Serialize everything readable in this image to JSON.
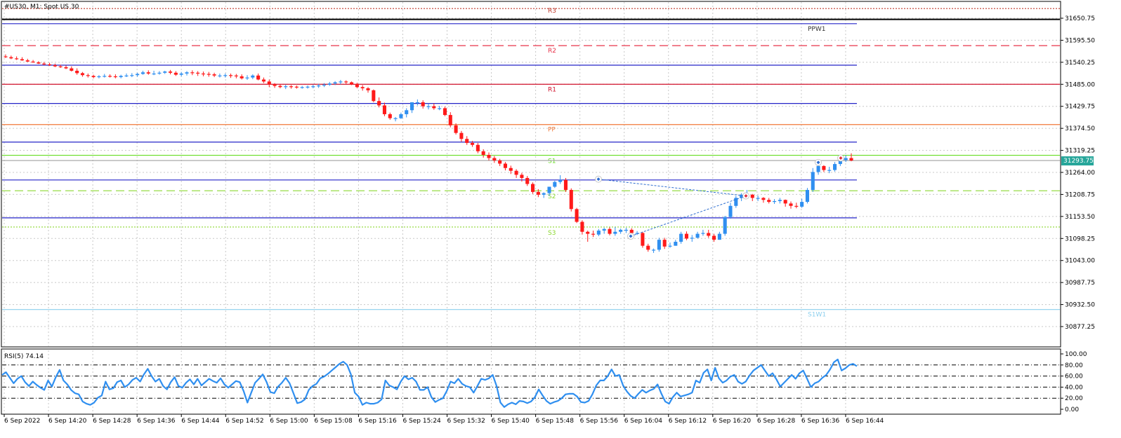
{
  "window": {
    "title": "#US30, M1:  Spot US 30"
  },
  "indicator": {
    "label": "RSI(5) 74.14"
  },
  "colors": {
    "bull": "#2f8ff0",
    "bear": "#ff1a1a",
    "rsi_line": "#2f8ff0",
    "grid": "#c8c8c8",
    "price_tag": "#26a69a"
  },
  "chart_data": [
    {
      "type": "candlestick",
      "title": "#US30, M1:  Spot US 30",
      "y_ticks": [
        "31650.75",
        "31595.50",
        "31540.25",
        "31485.00",
        "31429.75",
        "31374.50",
        "31319.25",
        "31264.00",
        "31208.75",
        "31153.50",
        "31098.25",
        "31043.00",
        "30987.75",
        "30932.50",
        "30877.25"
      ],
      "ylim": [
        30855,
        31668
      ],
      "x_ticks": [
        "6 Sep 2022",
        "6 Sep 14:20",
        "6 Sep 14:28",
        "6 Sep 14:36",
        "6 Sep 14:44",
        "6 Sep 14:52",
        "6 Sep 15:00",
        "6 Sep 15:08",
        "6 Sep 15:16",
        "6 Sep 15:24",
        "6 Sep 15:32",
        "6 Sep 15:40",
        "6 Sep 15:48",
        "6 Sep 15:56",
        "6 Sep 16:04",
        "6 Sep 16:12",
        "6 Sep 16:20",
        "6 Sep 16:28",
        "6 Sep 16:36",
        "6 Sep 16:44"
      ],
      "current_price": "31293.75",
      "levels": [
        {
          "label": "R3",
          "value": 31675,
          "color": "#c0392b",
          "style": "dotted"
        },
        {
          "label": "",
          "value": 31648,
          "color": "#000000",
          "style": "solid"
        },
        {
          "label": "PPW1",
          "value": 31637,
          "color": "#2424c8",
          "style": "solid"
        },
        {
          "label": "R2",
          "value": 31582,
          "color": "#e8334a",
          "style": "dashed"
        },
        {
          "label": "",
          "value": 31533,
          "color": "#2424c8",
          "style": "solid"
        },
        {
          "label": "R1",
          "value": 31485,
          "color": "#d0102a",
          "style": "solid"
        },
        {
          "label": "",
          "value": 31437,
          "color": "#2424c8",
          "style": "solid"
        },
        {
          "label": "PP",
          "value": 31384,
          "color": "#f07838",
          "style": "solid"
        },
        {
          "label": "",
          "value": 31340,
          "color": "#2424c8",
          "style": "solid"
        },
        {
          "label": "S1",
          "value": 31307,
          "color": "#66dd22",
          "style": "solid"
        },
        {
          "label": "",
          "value": 31293.75,
          "color": "#a0a0a0",
          "style": "solid"
        },
        {
          "label": "",
          "value": 31245,
          "color": "#2424c8",
          "style": "solid"
        },
        {
          "label": "S2",
          "value": 31218,
          "color": "#8cd830",
          "style": "dashed"
        },
        {
          "label": "",
          "value": 31150,
          "color": "#2424c8",
          "style": "solid"
        },
        {
          "label": "S3",
          "value": 31127,
          "color": "#8cd830",
          "style": "dotted"
        },
        {
          "label": "S1W1",
          "value": 30920,
          "color": "#8ccfee",
          "style": "solid"
        }
      ],
      "series": [
        {
          "name": "",
          "open": [
            31555,
            31553,
            31550,
            31548,
            31545,
            31542,
            31540,
            31537,
            31535,
            31533,
            31530,
            31528,
            31525,
            31519,
            31513,
            31508,
            31506,
            31503,
            31505,
            31506,
            31505,
            31503,
            31506,
            31507,
            31508,
            31511,
            31515,
            31512,
            31512,
            31514,
            31517,
            31514,
            31509,
            31512,
            31515,
            31514,
            31512,
            31511,
            31510,
            31507,
            31507,
            31508,
            31507,
            31505,
            31500,
            31502,
            31507,
            31497,
            31492,
            31485,
            31481,
            31478,
            31480,
            31479,
            31478,
            31478,
            31479,
            31480,
            31482,
            31484,
            31487,
            31490,
            31492,
            31490,
            31485,
            31478,
            31475,
            31470,
            31443,
            31432,
            31410,
            31400,
            31400,
            31410,
            31420,
            31440,
            31440,
            31430,
            31430,
            31425,
            31425,
            31408,
            31382,
            31363,
            31348,
            31338,
            31333,
            31317,
            31308,
            31300,
            31294,
            31286,
            31275,
            31268,
            31258,
            31250,
            31235,
            31215,
            31208,
            31212,
            31228,
            31240,
            31245,
            31220,
            31172,
            31140,
            31115,
            31110,
            31108,
            31118,
            31122,
            31110,
            31115,
            31120,
            31120,
            31112,
            31112,
            31080,
            31070,
            31070,
            31095,
            31078,
            31080,
            31090,
            31110,
            31098,
            31100,
            31110,
            31112,
            31105,
            31095,
            31110,
            31152,
            31180,
            31200,
            31208,
            31208,
            31200,
            31200,
            31195,
            31190,
            31192,
            31195,
            31186,
            31180,
            31178,
            31190,
            31220,
            31265,
            31280,
            31270,
            31270,
            31285,
            31295,
            31300
          ],
          "high": [
            31560,
            31557,
            31555,
            31553,
            31549,
            31546,
            31543,
            31541,
            31539,
            31537,
            31534,
            31532,
            31530,
            31525,
            31516,
            31512,
            31509,
            31508,
            31511,
            31510,
            31510,
            31509,
            31512,
            31513,
            31514,
            31519,
            31520,
            31519,
            31518,
            31519,
            31521,
            31518,
            31516,
            31518,
            31520,
            31518,
            31517,
            31516,
            31514,
            31512,
            31512,
            31512,
            31511,
            31510,
            31508,
            31510,
            31512,
            31502,
            31497,
            31488,
            31485,
            31484,
            31483,
            31482,
            31481,
            31482,
            31484,
            31486,
            31488,
            31491,
            31493,
            31496,
            31495,
            31492,
            31489,
            31483,
            31478,
            31472,
            31452,
            31439,
            31414,
            31403,
            31414,
            31425,
            31435,
            31447,
            31445,
            31437,
            31437,
            31431,
            31429,
            31415,
            31387,
            31368,
            31355,
            31343,
            31338,
            31322,
            31314,
            31305,
            31298,
            31290,
            31281,
            31272,
            31263,
            31255,
            31239,
            31222,
            31214,
            31227,
            31243,
            31257,
            31250,
            31224,
            31175,
            31144,
            31118,
            31118,
            31122,
            31125,
            31126,
            31127,
            31123,
            31125,
            31124,
            31117,
            31115,
            31085,
            31073,
            31100,
            31100,
            31088,
            31095,
            31115,
            31116,
            31107,
            31115,
            31120,
            31120,
            31110,
            31115,
            31155,
            31188,
            31205,
            31212,
            31220,
            31210,
            31206,
            31202,
            31200,
            31197,
            31200,
            31196,
            31191,
            31188,
            31198,
            31225,
            31275,
            31295,
            31282,
            31278,
            31290,
            31300,
            31307,
            31312
          ],
          "low": [
            31551,
            31548,
            31546,
            31544,
            31541,
            31539,
            31536,
            31533,
            31531,
            31528,
            31526,
            31523,
            31517,
            31509,
            31504,
            31502,
            31500,
            31500,
            31502,
            31502,
            31500,
            31500,
            31503,
            31503,
            31504,
            31509,
            31509,
            31508,
            31509,
            31511,
            31510,
            31506,
            31505,
            31507,
            31508,
            31506,
            31505,
            31504,
            31503,
            31502,
            31502,
            31501,
            31500,
            31497,
            31496,
            31498,
            31495,
            31488,
            31478,
            31476,
            31475,
            31473,
            31474,
            31474,
            31474,
            31474,
            31475,
            31476,
            31478,
            31481,
            31483,
            31485,
            31486,
            31483,
            31475,
            31469,
            31464,
            31440,
            31427,
            31405,
            31396,
            31392,
            31398,
            31402,
            31413,
            31432,
            31424,
            31422,
            31421,
            31420,
            31405,
            31377,
            31359,
            31341,
            31333,
            31328,
            31312,
            31301,
            31294,
            31288,
            31280,
            31269,
            31260,
            31250,
            31241,
            31230,
            31210,
            31202,
            31200,
            31205,
            31225,
            31235,
            31215,
            31166,
            31137,
            31108,
            31090,
            31102,
            31104,
            31110,
            31106,
            31105,
            31110,
            31112,
            31108,
            31107,
            31075,
            31065,
            31062,
            31065,
            31072,
            31075,
            31080,
            31085,
            31094,
            31090,
            31098,
            31105,
            31100,
            31090,
            31095,
            31105,
            31148,
            31175,
            31192,
            31198,
            31192,
            31192,
            31188,
            31186,
            31185,
            31186,
            31178,
            31173,
            31174,
            31175,
            31186,
            31215,
            31258,
            31265,
            31262,
            31266,
            31280,
            31290,
            31292
          ],
          "close": [
            31553,
            31550,
            31548,
            31545,
            31542,
            31540,
            31537,
            31535,
            31533,
            31530,
            31528,
            31525,
            31519,
            31513,
            31508,
            31506,
            31503,
            31505,
            31506,
            31505,
            31503,
            31506,
            31507,
            31508,
            31511,
            31515,
            31512,
            31512,
            31514,
            31517,
            31514,
            31509,
            31512,
            31515,
            31514,
            31512,
            31511,
            31510,
            31507,
            31507,
            31508,
            31507,
            31505,
            31500,
            31502,
            31507,
            31497,
            31492,
            31485,
            31481,
            31478,
            31480,
            31479,
            31478,
            31478,
            31479,
            31480,
            31482,
            31484,
            31487,
            31490,
            31492,
            31490,
            31485,
            31478,
            31475,
            31470,
            31443,
            31432,
            31410,
            31400,
            31400,
            31410,
            31420,
            31440,
            31440,
            31430,
            31430,
            31425,
            31425,
            31408,
            31382,
            31363,
            31348,
            31338,
            31333,
            31317,
            31308,
            31300,
            31294,
            31286,
            31275,
            31268,
            31258,
            31250,
            31235,
            31215,
            31208,
            31212,
            31228,
            31240,
            31245,
            31220,
            31172,
            31140,
            31115,
            31110,
            31108,
            31118,
            31122,
            31110,
            31115,
            31120,
            31120,
            31112,
            31112,
            31080,
            31070,
            31070,
            31095,
            31078,
            31080,
            31090,
            31110,
            31098,
            31100,
            31110,
            31112,
            31105,
            31095,
            31110,
            31152,
            31180,
            31200,
            31208,
            31208,
            31200,
            31200,
            31195,
            31190,
            31192,
            31195,
            31186,
            31180,
            31178,
            31190,
            31220,
            31265,
            31280,
            31270,
            31270,
            31285,
            31295,
            31300,
            31293.75
          ]
        }
      ]
    },
    {
      "type": "line",
      "title": "RSI(5) 74.14",
      "y_ticks": [
        "100.00",
        "80.00",
        "60.00",
        "40.00",
        "20.00",
        "0.00"
      ],
      "ylim": [
        0,
        100
      ],
      "series": [
        {
          "name": "",
          "values": [
            62,
            67,
            57,
            47,
            55,
            60,
            49,
            42,
            50,
            44,
            39,
            35,
            52,
            41,
            58,
            71,
            52,
            45,
            35,
            29,
            27,
            14,
            10,
            8,
            12,
            21,
            25,
            50,
            36,
            38,
            49,
            52,
            40,
            45,
            53,
            57,
            50,
            63,
            73,
            60,
            50,
            55,
            42,
            36,
            49,
            58,
            42,
            39,
            48,
            54,
            45,
            55,
            43,
            49,
            55,
            51,
            48,
            56,
            45,
            39,
            45,
            51,
            49,
            33,
            12,
            30,
            48,
            55,
            63,
            49,
            31,
            29,
            41,
            48,
            57,
            47,
            29,
            11,
            13,
            18,
            35,
            42,
            46,
            56,
            59,
            64,
            70,
            76,
            82,
            86,
            80,
            63,
            30,
            23,
            8,
            12,
            10,
            10,
            12,
            18,
            52,
            43,
            40,
            36,
            50,
            60,
            54,
            57,
            50,
            35,
            35,
            40,
            22,
            13,
            17,
            20,
            33,
            50,
            47,
            55,
            46,
            42,
            40,
            30,
            42,
            55,
            53,
            56,
            62,
            42,
            12,
            4,
            9,
            12,
            9,
            15,
            14,
            11,
            14,
            22,
            36,
            25,
            15,
            10,
            13,
            15,
            20,
            27,
            28,
            28,
            23,
            13,
            12,
            15,
            27,
            43,
            52,
            52,
            60,
            72,
            60,
            62,
            43,
            32,
            24,
            20,
            28,
            35,
            30,
            34,
            37,
            45,
            28,
            14,
            10,
            22,
            30,
            23,
            25,
            27,
            30,
            52,
            48,
            66,
            72,
            52,
            75,
            56,
            48,
            52,
            59,
            62,
            50,
            46,
            50,
            61,
            70,
            75,
            80,
            70,
            60,
            65,
            54,
            41,
            48,
            55,
            62,
            55,
            65,
            70,
            55,
            40,
            47,
            50,
            57,
            62,
            72,
            85,
            90,
            70,
            74,
            80,
            82,
            78
          ]
        }
      ]
    }
  ]
}
